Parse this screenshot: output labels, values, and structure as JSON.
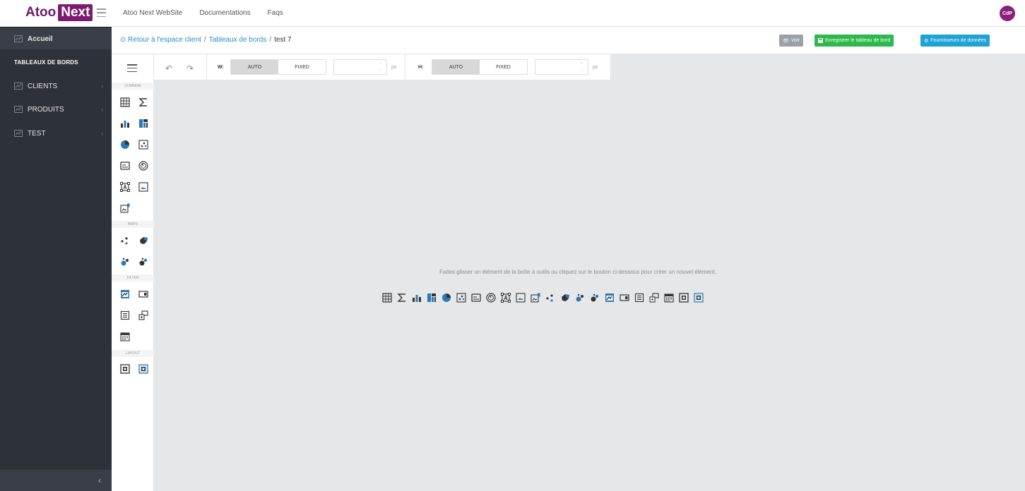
{
  "topbar": {
    "logo_part1": "Atoo",
    "logo_part2": "Next",
    "nav": [
      "Atoo Next WebSite",
      "Documentations",
      "Faqs"
    ],
    "avatar_initials": "CdP"
  },
  "sidebar": {
    "home": "Accueil",
    "section_title": "TABLEAUX DE BORDS",
    "items": [
      {
        "label": "CLIENTS"
      },
      {
        "label": "PRODUITS"
      },
      {
        "label": "TEST"
      }
    ]
  },
  "breadcrumb": {
    "back": "Retour à l'espace client",
    "sep1": "/",
    "level1": "Tableaux de bords",
    "sep2": "/",
    "current": "test 7"
  },
  "actions": {
    "view": "Voir",
    "save": "Enregistrer le tableau de bord",
    "providers": "Fournisseurs de données"
  },
  "toolbox": {
    "sections": [
      "COMMON",
      "MAPS",
      "FILTER",
      "LAYOUT"
    ]
  },
  "toolbar": {
    "w_label": "W:",
    "h_label": "H:",
    "auto": "AUTO",
    "fixed": "FIXED",
    "unit": "px"
  },
  "canvas": {
    "hint": "Faites glisser un élément de la boîte à outils ou cliquez sur le bouton ci-dessous pour créer un nouvel élément."
  },
  "colors": {
    "brand": "#7b1b70",
    "sidebar_bg": "#2d3138",
    "canvas_bg": "#e6e7e9",
    "save_green": "#2cb84a",
    "provider_blue": "#1fa2d6",
    "icon_blue": "#2a7ab8"
  }
}
